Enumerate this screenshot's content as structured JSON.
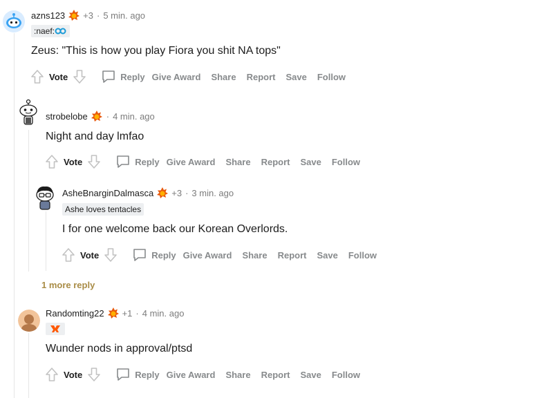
{
  "actions": {
    "vote": "Vote",
    "reply": "Reply",
    "give_award": "Give Award",
    "share": "Share",
    "report": "Report",
    "save": "Save",
    "follow": "Follow"
  },
  "comments": [
    {
      "username": "azns123",
      "score": "+3",
      "time": "5 min. ago",
      "flair": ":naef:",
      "body": "Zeus: \"This is how you play Fiora you shit NA tops\""
    },
    {
      "username": "strobelobe",
      "time": "4 min. ago",
      "body": "Night and day lmfao"
    },
    {
      "username": "AsheBnarginDalmasca",
      "score": "+3",
      "time": "3 min. ago",
      "flair": "Ashe loves tentacles",
      "body": "I for one welcome back our Korean Overlords."
    },
    {
      "username": "Randomting22",
      "score": "+1",
      "time": "4 min. ago",
      "body": "Wunder nods in approval/ptsd"
    }
  ],
  "more_replies": "1 more reply",
  "separator": "·",
  "colors": {
    "meta": "#7c7c7c",
    "action": "#878a8c",
    "more_replies": "#a98c46",
    "flair_bg": "#edeff1",
    "award": "#e8590c"
  },
  "icons": [
    "snoo-avatar-icon",
    "award-flame-icon",
    "upvote-arrow-icon",
    "downvote-arrow-icon",
    "comment-bubble-icon",
    "c9-logo-icon",
    "fnatic-logo-icon"
  ]
}
